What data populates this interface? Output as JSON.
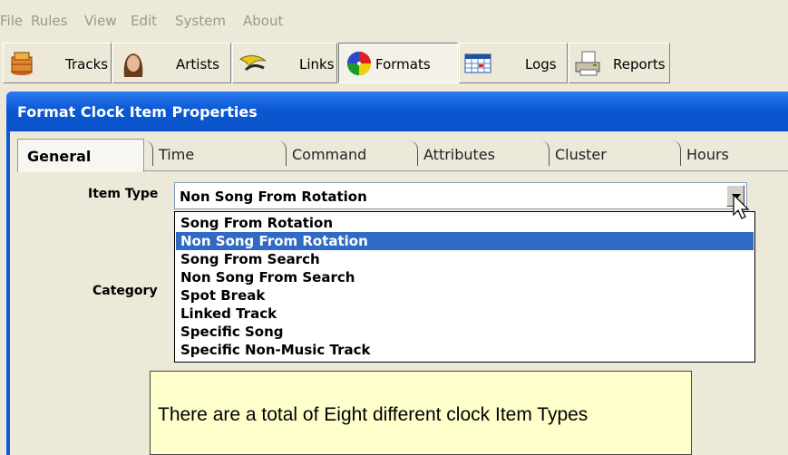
{
  "menu": [
    "File",
    "Rules",
    "View",
    "Edit",
    "System",
    "About"
  ],
  "toolbar": {
    "buttons": [
      {
        "label": "Tracks",
        "icon": "tracks-icon"
      },
      {
        "label": "Artists",
        "icon": "artists-icon"
      },
      {
        "label": "Links",
        "icon": "links-icon"
      },
      {
        "label": "Formats",
        "icon": "formats-icon",
        "active": true
      },
      {
        "label": "Logs",
        "icon": "logs-icon"
      },
      {
        "label": "Reports",
        "icon": "reports-icon"
      }
    ]
  },
  "dialog": {
    "title": "Format Clock Item Properties",
    "tabs": [
      "General",
      "Time",
      "Command",
      "Attributes",
      "Cluster",
      "Hours"
    ],
    "selected_tab": "General",
    "item_type_label": "Item Type",
    "item_type_value": "Non Song From Rotation",
    "category_label": "Category",
    "item_type_options": [
      "Song From Rotation",
      "Non Song From Rotation",
      "Song From Search",
      "Non Song From Search",
      "Spot Break",
      "Linked Track",
      "Specific Song",
      "Specific Non-Music Track"
    ],
    "highlighted_option": "Non Song From Rotation"
  },
  "callout": {
    "text": "There are a total of Eight different clock Item Types"
  },
  "colors": {
    "title_bar": "#0a5bd8",
    "highlight": "#316ac5",
    "callout_bg": "#ffffcc"
  }
}
